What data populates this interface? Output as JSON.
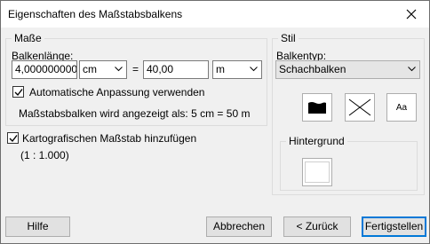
{
  "window": {
    "title": "Eigenschaften des Maßstabsbalkens"
  },
  "masse": {
    "group_label": "Maße",
    "balkenlaenge_label": "Balkenlänge:",
    "length_value": "4,000000000",
    "length_unit": "cm",
    "equals": "=",
    "map_value": "40,00",
    "map_unit": "m",
    "auto_adjust_label": "Automatische Anpassung verwenden",
    "auto_adjust_checked": true,
    "display_info": "Maßstabsbalken wird angezeigt als: 5 cm = 50 m"
  },
  "cartographic": {
    "label": "Kartografischen Maßstab hinzufügen",
    "checked": true,
    "scale_text": "(1 : 1.000)"
  },
  "stil": {
    "group_label": "Stil",
    "balkentyp_label": "Balkentyp:",
    "balkentyp_value": "Schachbalken",
    "font_button_label": "Aa",
    "hintergrund_label": "Hintergrund"
  },
  "buttons": {
    "help": "Hilfe",
    "cancel": "Abbrechen",
    "back": "< Zurück",
    "finish": "Fertigstellen"
  }
}
